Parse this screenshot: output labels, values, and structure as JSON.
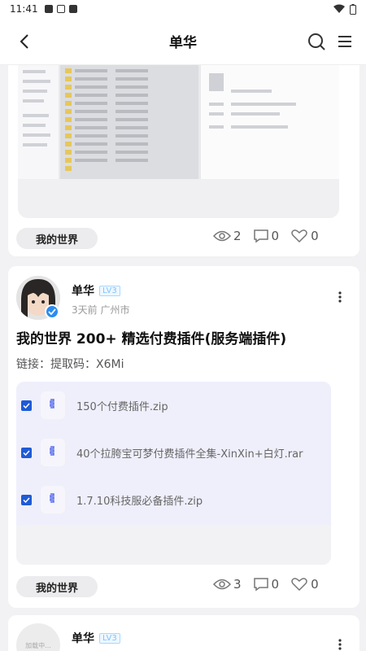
{
  "status_bar": {
    "time": "11:41"
  },
  "header": {
    "title": "单华"
  },
  "posts": [
    {
      "tag": "我的世界",
      "views": "2",
      "comments": "0",
      "likes": "0"
    },
    {
      "author": "单华",
      "level": "LV3",
      "meta": "3天前 广州市",
      "title": "我的世界 200+ 精选付费插件(服务端插件)",
      "link_text": "链接：提取码：X6Mi",
      "files": [
        {
          "name": "150个付费插件.zip"
        },
        {
          "name": "40个拉胯宝可梦付费插件全集-XinXin+白灯.rar"
        },
        {
          "name": "1.7.10科技服必备插件.zip"
        }
      ],
      "tag": "我的世界",
      "views": "3",
      "comments": "0",
      "likes": "0"
    },
    {
      "author": "单华",
      "level": "LV3",
      "avatar_text": "加载中..."
    }
  ],
  "colors": {
    "accent": "#1e5bd6",
    "verify": "#2b8cf0",
    "level": "#7ec4ff"
  }
}
